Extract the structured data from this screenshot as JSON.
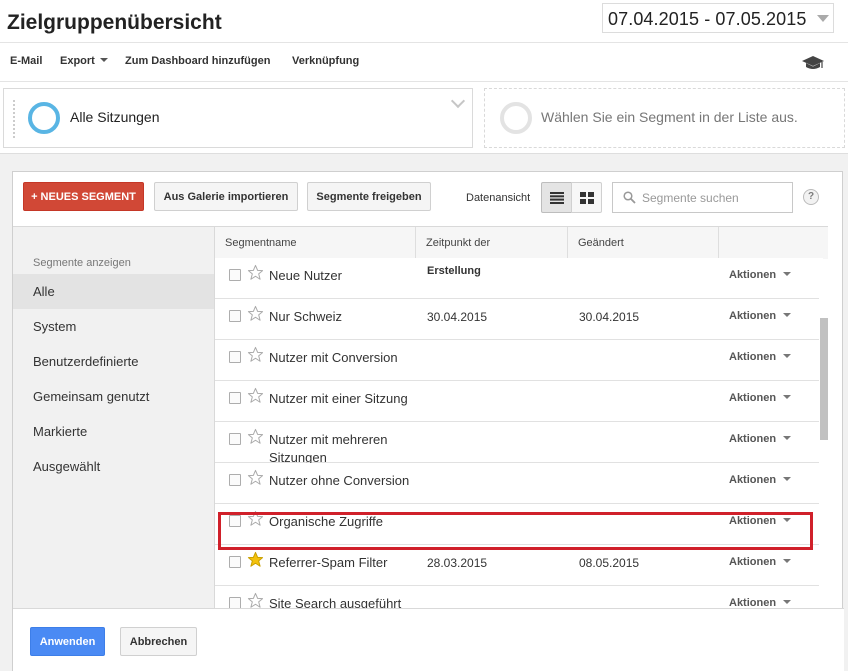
{
  "header": {
    "title": "Zielgruppenübersicht",
    "date_range": "07.04.2015 - 07.05.2015"
  },
  "toolbar": {
    "email": "E-Mail",
    "export": "Export",
    "add_dashboard": "Zum Dashboard hinzufügen",
    "shortcut": "Verknüpfung",
    "icon": "graduation-cap-icon"
  },
  "segment_bar": {
    "active_segment": "Alle Sitzungen",
    "empty_slot": "Wählen Sie ein Segment in der Liste aus."
  },
  "dialog": {
    "new_segment": "+ NEUES SEGMENT",
    "import_gallery": "Aus Galerie importieren",
    "share_segments": "Segmente freigeben",
    "view_label": "Datenansicht",
    "search_placeholder": "Segmente suchen",
    "help": "?"
  },
  "nav": {
    "heading": "Segmente anzeigen",
    "items": [
      "Alle",
      "System",
      "Benutzerdefinierte",
      "Gemeinsam genutzt",
      "Markierte",
      "Ausgewählt"
    ]
  },
  "table": {
    "headers": [
      "Segmentname",
      "Zeitpunkt der",
      "Geändert"
    ],
    "header_sub": "Erstellung",
    "action_label": "Aktionen",
    "rows": [
      {
        "name": "Neue Nutzer",
        "created": "",
        "modified": "",
        "starred": false
      },
      {
        "name": "Nur Schweiz",
        "created": "30.04.2015",
        "modified": "30.04.2015",
        "starred": false
      },
      {
        "name": "Nutzer mit Conversion",
        "created": "",
        "modified": "",
        "starred": false
      },
      {
        "name": "Nutzer mit einer Sitzung",
        "created": "",
        "modified": "",
        "starred": false
      },
      {
        "name": "Nutzer mit mehreren Sitzungen",
        "created": "",
        "modified": "",
        "starred": false
      },
      {
        "name": "Nutzer ohne Conversion",
        "created": "",
        "modified": "",
        "starred": false
      },
      {
        "name": "Organische Zugriffe",
        "created": "",
        "modified": "",
        "starred": false
      },
      {
        "name": "Referrer-Spam Filter",
        "created": "28.03.2015",
        "modified": "08.05.2015",
        "starred": true
      },
      {
        "name": "Site Search ausgeführt",
        "created": "",
        "modified": "",
        "starred": false
      }
    ]
  },
  "footer": {
    "apply": "Anwenden",
    "cancel": "Abbrechen"
  },
  "colors": {
    "new_segment_button": "#d14836",
    "apply_button": "#4a8af4",
    "highlight_border": "#d0202a",
    "ring_active": "#59b5e4",
    "star_filled": "#f4c20d"
  }
}
